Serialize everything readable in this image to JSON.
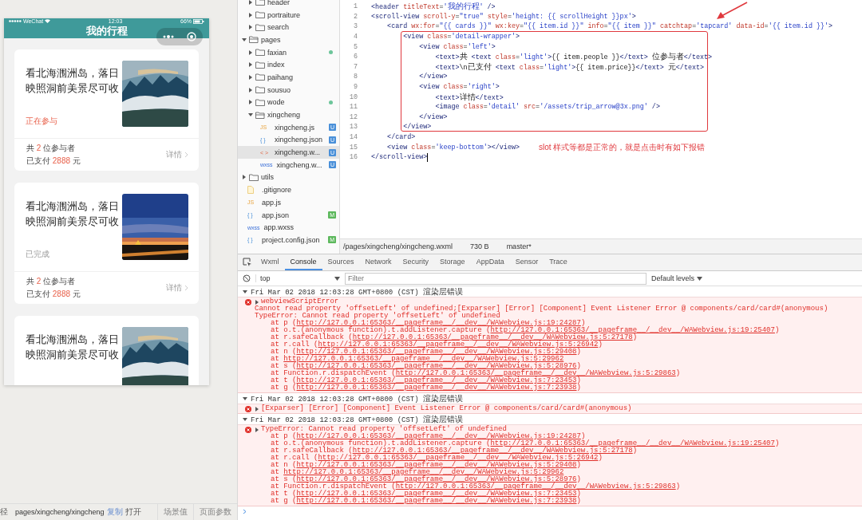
{
  "phone": {
    "status_bar": {
      "carrier": "WeChat",
      "time": "12:03",
      "battery": "66%"
    },
    "nav_title": "我的行程",
    "cards": [
      {
        "title": "看北海涠洲岛，落日映照洞前美景尽可收",
        "status": {
          "kind": "active",
          "text": "正在参与"
        },
        "participants": {
          "before": "共",
          "value": "2",
          "after": "位参与者"
        },
        "payment": {
          "before": "已支付",
          "value": "2888",
          "after": "元"
        },
        "detail": "详情"
      },
      {
        "title": "看北海涠洲岛，落日映照洞前美景尽可收",
        "status": {
          "kind": "done",
          "text": "已完成"
        },
        "participants": {
          "before": "共",
          "value": "2",
          "after": "位参与者"
        },
        "payment": {
          "before": "已支付",
          "value": "2888",
          "after": "元"
        },
        "detail": "详情"
      },
      {
        "title": "看北海涠洲岛，落日映照洞前美景尽可收"
      }
    ]
  },
  "bottom_bar": {
    "path_label": "径",
    "path": "pages/xingcheng/xingcheng",
    "copy": "复制",
    "open": "打开",
    "scene": "场景值",
    "params": "页面参数"
  },
  "tree": {
    "continued_children": [
      {
        "kind": "folder",
        "name": "header",
        "expanded": false,
        "selected": false
      },
      {
        "kind": "folder",
        "name": "portraiture",
        "expanded": false,
        "selected": false
      },
      {
        "kind": "folder",
        "name": "search",
        "expanded": false,
        "selected": false
      }
    ],
    "items": [
      {
        "kind": "folder",
        "name": "pages",
        "expanded": true,
        "selected": false,
        "children": [
          {
            "kind": "folder",
            "name": "faxian",
            "expanded": false,
            "selected": false,
            "badge": {
              "kind": "dot"
            }
          },
          {
            "kind": "folder",
            "name": "index",
            "expanded": false,
            "selected": false
          },
          {
            "kind": "folder",
            "name": "paihang",
            "expanded": false,
            "selected": false
          },
          {
            "kind": "folder",
            "name": "sousuo",
            "expanded": false,
            "selected": false
          },
          {
            "kind": "folder",
            "name": "wode",
            "expanded": false,
            "selected": false,
            "badge": {
              "kind": "dot"
            }
          },
          {
            "kind": "folder",
            "name": "xingcheng",
            "expanded": true,
            "selected": false,
            "children": [
              {
                "kind": "script",
                "icon": "JS",
                "name": "xingcheng.js",
                "selected": false,
                "badge": {
                  "kind": "untracked",
                  "text": "U"
                }
              },
              {
                "kind": "data",
                "icon": "{ }",
                "name": "xingcheng.json",
                "selected": false,
                "badge": {
                  "kind": "untracked",
                  "text": "U"
                }
              },
              {
                "kind": "markup",
                "icon": "< >",
                "name": "xingcheng.w...",
                "selected": true,
                "badge": {
                  "kind": "untracked",
                  "text": "U"
                }
              },
              {
                "kind": "style",
                "icon": "wxss",
                "name": "xingcheng.w...",
                "selected": false,
                "badge": {
                  "kind": "untracked",
                  "text": "U"
                }
              }
            ]
          }
        ]
      },
      {
        "kind": "folder",
        "name": "utils",
        "expanded": false,
        "selected": false
      },
      {
        "kind": "plain",
        "name": ".gitignore",
        "selected": false
      },
      {
        "kind": "script",
        "icon": "JS",
        "name": "app.js",
        "selected": false
      },
      {
        "kind": "data",
        "icon": "{ }",
        "name": "app.json",
        "selected": false,
        "badge": {
          "kind": "modified",
          "text": "M"
        }
      },
      {
        "kind": "style",
        "icon": "wxss",
        "name": "app.wxss",
        "selected": false
      },
      {
        "kind": "data",
        "icon": "{ }",
        "name": "project.config.json",
        "selected": false,
        "badge": {
          "kind": "modified",
          "text": "M"
        }
      }
    ]
  },
  "editor": {
    "lines": [
      {
        "number": "1",
        "tokens": [
          {
            "kind": "tag",
            "text": "<header"
          },
          {
            "kind": "attr",
            "text": " titleText"
          },
          {
            "kind": "plain",
            "text": "="
          },
          {
            "kind": "str",
            "text": "'我的行程'"
          },
          {
            "kind": "tag",
            "text": " />"
          }
        ]
      },
      {
        "number": "2",
        "tokens": [
          {
            "kind": "tag",
            "text": "<scroll-view"
          },
          {
            "kind": "attr",
            "text": " scroll-y"
          },
          {
            "kind": "plain",
            "text": "="
          },
          {
            "kind": "str",
            "text": "\"true\""
          },
          {
            "kind": "attr",
            "text": " style"
          },
          {
            "kind": "plain",
            "text": "="
          },
          {
            "kind": "str",
            "text": "'height: {{ scrollHeight }}px'"
          },
          {
            "kind": "tag",
            "text": ">"
          }
        ]
      },
      {
        "number": "3",
        "tokens": [
          {
            "kind": "tag",
            "text": "    <card"
          },
          {
            "kind": "attr",
            "text": " wx:for"
          },
          {
            "kind": "plain",
            "text": "="
          },
          {
            "kind": "str",
            "text": "\"{{ cards }}\""
          },
          {
            "kind": "attr",
            "text": " wx:key"
          },
          {
            "kind": "plain",
            "text": "="
          },
          {
            "kind": "str",
            "text": "\"{{ item.id }}\""
          },
          {
            "kind": "attr",
            "text": " info"
          },
          {
            "kind": "plain",
            "text": "="
          },
          {
            "kind": "str",
            "text": "\"{{ item }}\""
          },
          {
            "kind": "attr",
            "text": " catchtap"
          },
          {
            "kind": "plain",
            "text": "="
          },
          {
            "kind": "str",
            "text": "'tapcard'"
          },
          {
            "kind": "attr",
            "text": " data-id"
          },
          {
            "kind": "plain",
            "text": "="
          },
          {
            "kind": "str",
            "text": "'{{ item.id }}'"
          },
          {
            "kind": "tag",
            "text": ">"
          }
        ]
      },
      {
        "number": "4",
        "tokens": [
          {
            "kind": "tag",
            "text": "        <view"
          },
          {
            "kind": "attr",
            "text": " class"
          },
          {
            "kind": "plain",
            "text": "="
          },
          {
            "kind": "str",
            "text": "'detail-wrapper'"
          },
          {
            "kind": "tag",
            "text": ">"
          }
        ]
      },
      {
        "number": "5",
        "tokens": [
          {
            "kind": "tag",
            "text": "            <view"
          },
          {
            "kind": "attr",
            "text": " class"
          },
          {
            "kind": "plain",
            "text": "="
          },
          {
            "kind": "str",
            "text": "'left'"
          },
          {
            "kind": "tag",
            "text": ">"
          }
        ]
      },
      {
        "number": "6",
        "tokens": [
          {
            "kind": "tag",
            "text": "                <text>"
          },
          {
            "kind": "plain",
            "text": "共 "
          },
          {
            "kind": "tag",
            "text": "<text"
          },
          {
            "kind": "attr",
            "text": " class"
          },
          {
            "kind": "plain",
            "text": "="
          },
          {
            "kind": "str",
            "text": "'light'"
          },
          {
            "kind": "tag",
            "text": ">"
          },
          {
            "kind": "plain",
            "text": "{{ item.people }}"
          },
          {
            "kind": "tag",
            "text": "</text>"
          },
          {
            "kind": "plain",
            "text": " 位参与者"
          },
          {
            "kind": "tag",
            "text": "</text>"
          }
        ]
      },
      {
        "number": "7",
        "tokens": [
          {
            "kind": "tag",
            "text": "                <text>"
          },
          {
            "kind": "plain",
            "text": "\\n已支付 "
          },
          {
            "kind": "tag",
            "text": "<text"
          },
          {
            "kind": "attr",
            "text": " class"
          },
          {
            "kind": "plain",
            "text": "="
          },
          {
            "kind": "str",
            "text": "'light'"
          },
          {
            "kind": "tag",
            "text": ">"
          },
          {
            "kind": "plain",
            "text": "{{ item.price}}"
          },
          {
            "kind": "tag",
            "text": "</text>"
          },
          {
            "kind": "plain",
            "text": " 元"
          },
          {
            "kind": "tag",
            "text": "</text>"
          }
        ]
      },
      {
        "number": "8",
        "tokens": [
          {
            "kind": "tag",
            "text": "            </view>"
          }
        ]
      },
      {
        "number": "9",
        "tokens": [
          {
            "kind": "tag",
            "text": "            <view"
          },
          {
            "kind": "attr",
            "text": " class"
          },
          {
            "kind": "plain",
            "text": "="
          },
          {
            "kind": "str",
            "text": "'right'"
          },
          {
            "kind": "tag",
            "text": ">"
          }
        ]
      },
      {
        "number": "10",
        "tokens": [
          {
            "kind": "tag",
            "text": "                <text>"
          },
          {
            "kind": "plain",
            "text": "详情"
          },
          {
            "kind": "tag",
            "text": "</text>"
          }
        ]
      },
      {
        "number": "11",
        "tokens": [
          {
            "kind": "tag",
            "text": "                <image"
          },
          {
            "kind": "attr",
            "text": " class"
          },
          {
            "kind": "plain",
            "text": "="
          },
          {
            "kind": "str",
            "text": "'detail'"
          },
          {
            "kind": "attr",
            "text": " src"
          },
          {
            "kind": "plain",
            "text": "="
          },
          {
            "kind": "str",
            "text": "'/assets/trip_arrow@3x.png'"
          },
          {
            "kind": "tag",
            "text": " />"
          }
        ]
      },
      {
        "number": "12",
        "tokens": [
          {
            "kind": "tag",
            "text": "            </view>"
          }
        ]
      },
      {
        "number": "13",
        "tokens": [
          {
            "kind": "tag",
            "text": "        </view>"
          }
        ]
      },
      {
        "number": "14",
        "tokens": [
          {
            "kind": "tag",
            "text": "    </card>"
          }
        ]
      },
      {
        "number": "15",
        "tokens": [
          {
            "kind": "tag",
            "text": "    <view"
          },
          {
            "kind": "attr",
            "text": " class"
          },
          {
            "kind": "plain",
            "text": "="
          },
          {
            "kind": "str",
            "text": "'keep-bottom'"
          },
          {
            "kind": "tag",
            "text": "></view>"
          }
        ]
      },
      {
        "number": "16",
        "cursor": true,
        "tokens": [
          {
            "kind": "tag",
            "text": "</scroll-view>"
          }
        ]
      }
    ],
    "annotation": "slot 样式等都是正常的，就是点击时有如下报错"
  },
  "path_bar": {
    "path": "/pages/xingcheng/xingcheng.wxml",
    "size": "730 B",
    "branch": "master*"
  },
  "devtools": {
    "tabs": [
      {
        "label": "Wxml",
        "selected": false
      },
      {
        "label": "Console",
        "selected": true
      },
      {
        "label": "Sources",
        "selected": false
      },
      {
        "label": "Network",
        "selected": false
      },
      {
        "label": "Security",
        "selected": false
      },
      {
        "label": "Storage",
        "selected": false
      },
      {
        "label": "AppData",
        "selected": false
      },
      {
        "label": "Sensor",
        "selected": false
      },
      {
        "label": "Trace",
        "selected": false
      }
    ],
    "context": "top",
    "filter_placeholder": "Filter",
    "levels": "Default levels",
    "groups": [
      {
        "expanded": true,
        "header": "Fri Mar 02 2018 12:03:28 GMT+0800 (CST) 渲染层错误",
        "error": {
          "expanded": false,
          "lines": [
            "webviewScriptError",
            "Cannot read property 'offsetLeft' of undefined;[Exparser] [Error] [Component] Event Listener Error @ components/card/card#(anonymous)",
            "TypeError: Cannot read property 'offsetLeft' of undefined"
          ],
          "stack": [
            {
              "pre": "at p (",
              "url": "http://127.0.0.1:65363/__pageframe__/__dev__/WAWebview.js:19:24287",
              "post": ")"
            },
            {
              "pre": "at o.t.(anonymous function).t.addListener.capture (",
              "url": "http://127.0.0.1:65363/__pageframe__/__dev__/WAWebview.js:19:25407",
              "post": ")"
            },
            {
              "pre": "at r.safeCallback (",
              "url": "http://127.0.0.1:65363/__pageframe__/__dev__/WAWebview.js:5:27178",
              "post": ")"
            },
            {
              "pre": "at r.call (",
              "url": "http://127.0.0.1:65363/__pageframe__/__dev__/WAWebview.js:5:26942",
              "post": ")"
            },
            {
              "pre": "at n (",
              "url": "http://127.0.0.1:65363/__pageframe__/__dev__/WAWebview.js:5:29408",
              "post": ")"
            },
            {
              "pre": "at",
              "url": "http://127.0.0.1:65363/__pageframe__/__dev__/WAWebview.js:5:29962"
            },
            {
              "pre": "at s (",
              "url": "http://127.0.0.1:65363/__pageframe__/__dev__/WAWebview.js:5:28976",
              "post": ")"
            },
            {
              "pre": "at Function.r.dispatchEvent (",
              "url": "http://127.0.0.1:65363/__pageframe__/__dev__/WAWebview.js:5:29863",
              "post": ")"
            },
            {
              "pre": "at t (",
              "url": "http://127.0.0.1:65363/__pageframe__/__dev__/WAWebview.js:7:23453",
              "post": ")"
            },
            {
              "pre": "at g (",
              "url": "http://127.0.0.1:65363/__pageframe__/__dev__/WAWebview.js:7:23938",
              "post": ")"
            }
          ]
        }
      },
      {
        "expanded": true,
        "header": "Fri Mar 02 2018 12:03:28 GMT+0800 (CST) 渲染层错误",
        "error": {
          "expanded": false,
          "lines": [
            "[Exparser] [Error] [Component] Event Listener Error @ components/card/card#(anonymous)"
          ]
        }
      },
      {
        "expanded": true,
        "header": "Fri Mar 02 2018 12:03:28 GMT+0800 (CST) 渲染层错误",
        "error": {
          "expanded": false,
          "lines": [
            "TypeError: Cannot read property 'offsetLeft' of undefined"
          ],
          "stack": [
            {
              "pre": "at p (",
              "url": "http://127.0.0.1:65363/__pageframe__/__dev__/WAWebview.js:19:24287",
              "post": ")"
            },
            {
              "pre": "at o.t.(anonymous function).t.addListener.capture (",
              "url": "http://127.0.0.1:65363/__pageframe__/__dev__/WAWebview.js:19:25407",
              "post": ")"
            },
            {
              "pre": "at r.safeCallback (",
              "url": "http://127.0.0.1:65363/__pageframe__/__dev__/WAWebview.js:5:27178",
              "post": ")"
            },
            {
              "pre": "at r.call (",
              "url": "http://127.0.0.1:65363/__pageframe__/__dev__/WAWebview.js:5:26942",
              "post": ")"
            },
            {
              "pre": "at n (",
              "url": "http://127.0.0.1:65363/__pageframe__/__dev__/WAWebview.js:5:29408",
              "post": ")"
            },
            {
              "pre": "at",
              "url": "http://127.0.0.1:65363/__pageframe__/__dev__/WAWebview.js:5:29962"
            },
            {
              "pre": "at s (",
              "url": "http://127.0.0.1:65363/__pageframe__/__dev__/WAWebview.js:5:28976",
              "post": ")"
            },
            {
              "pre": "at Function.r.dispatchEvent (",
              "url": "http://127.0.0.1:65363/__pageframe__/__dev__/WAWebview.js:5:29863",
              "post": ")"
            },
            {
              "pre": "at t (",
              "url": "http://127.0.0.1:65363/__pageframe__/__dev__/WAWebview.js:7:23453",
              "post": ")"
            },
            {
              "pre": "at g (",
              "url": "http://127.0.0.1:65363/__pageframe__/__dev__/WAWebview.js:7:23938",
              "post": ")"
            }
          ]
        }
      }
    ]
  }
}
